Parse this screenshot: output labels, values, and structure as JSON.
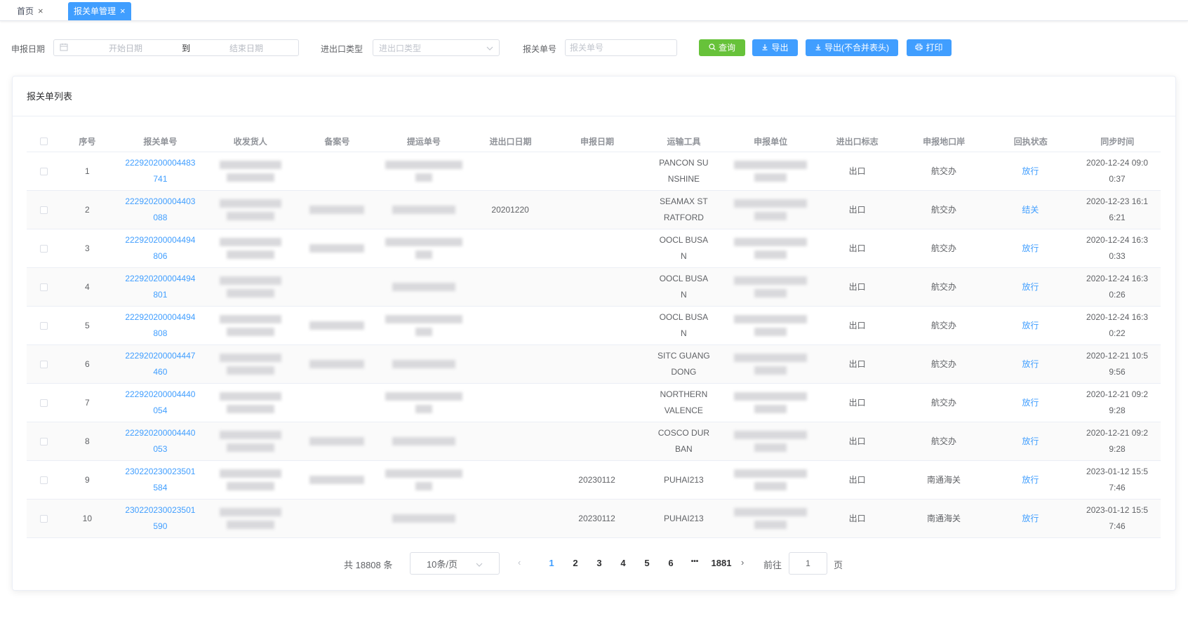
{
  "tabs": [
    {
      "label": "首页",
      "active": false
    },
    {
      "label": "报关单管理",
      "active": true
    }
  ],
  "filters": {
    "declare_date_label": "申报日期",
    "start_placeholder": "开始日期",
    "range_sep": "到",
    "end_placeholder": "结束日期",
    "ie_type_label": "进出口类型",
    "ie_type_placeholder": "进出口类型",
    "decl_no_label": "报关单号",
    "decl_no_placeholder": "报关单号"
  },
  "buttons": {
    "query": "查询",
    "export": "导出",
    "export_nomerge": "导出(不合并表头)",
    "print": "打印"
  },
  "card_title": "报关单列表",
  "columns": [
    "序号",
    "报关单号",
    "收发货人",
    "备案号",
    "提运单号",
    "进出口日期",
    "申报日期",
    "运输工具",
    "申报单位",
    "进出口标志",
    "申报地口岸",
    "回执状态",
    "同步时间"
  ],
  "rows": [
    {
      "idx": "1",
      "no": "222920200004483741",
      "ie_date": "",
      "decl_date": "",
      "transport": "PANCON SUNSHINE",
      "flag": "出口",
      "port": "航交办",
      "status": "放行",
      "sync": "2020-12-24 09:00:37"
    },
    {
      "idx": "2",
      "no": "222920200004403088",
      "ie_date": "20201220",
      "decl_date": "",
      "transport": "SEAMAX STRATFORD",
      "flag": "出口",
      "port": "航交办",
      "status": "结关",
      "sync": "2020-12-23 16:16:21"
    },
    {
      "idx": "3",
      "no": "222920200004494806",
      "ie_date": "",
      "decl_date": "",
      "transport": "OOCL BUSAN",
      "flag": "出口",
      "port": "航交办",
      "status": "放行",
      "sync": "2020-12-24 16:30:33"
    },
    {
      "idx": "4",
      "no": "222920200004494801",
      "ie_date": "",
      "decl_date": "",
      "transport": "OOCL BUSAN",
      "flag": "出口",
      "port": "航交办",
      "status": "放行",
      "sync": "2020-12-24 16:30:26"
    },
    {
      "idx": "5",
      "no": "222920200004494808",
      "ie_date": "",
      "decl_date": "",
      "transport": "OOCL BUSAN",
      "flag": "出口",
      "port": "航交办",
      "status": "放行",
      "sync": "2020-12-24 16:30:22"
    },
    {
      "idx": "6",
      "no": "222920200004447460",
      "ie_date": "",
      "decl_date": "",
      "transport": "SITC GUANGDONG",
      "flag": "出口",
      "port": "航交办",
      "status": "放行",
      "sync": "2020-12-21 10:59:56"
    },
    {
      "idx": "7",
      "no": "222920200004440054",
      "ie_date": "",
      "decl_date": "",
      "transport": "NORTHERN VALENCE",
      "flag": "出口",
      "port": "航交办",
      "status": "放行",
      "sync": "2020-12-21 09:29:28"
    },
    {
      "idx": "8",
      "no": "222920200004440053",
      "ie_date": "",
      "decl_date": "",
      "transport": "COSCO DURBAN",
      "flag": "出口",
      "port": "航交办",
      "status": "放行",
      "sync": "2020-12-21 09:29:28"
    },
    {
      "idx": "9",
      "no": "230220230023501584",
      "ie_date": "",
      "decl_date": "20230112",
      "transport": "PUHAI213",
      "flag": "出口",
      "port": "南通海关",
      "status": "放行",
      "sync": "2023-01-12 15:57:46"
    },
    {
      "idx": "10",
      "no": "230220230023501590",
      "ie_date": "",
      "decl_date": "20230112",
      "transport": "PUHAI213",
      "flag": "出口",
      "port": "南通海关",
      "status": "放行",
      "sync": "2023-01-12 15:57:46"
    }
  ],
  "pagination": {
    "total": "共 18808 条",
    "page_size": "10条/页",
    "pages": [
      "1",
      "2",
      "3",
      "4",
      "5",
      "6"
    ],
    "ellipsis": "•••",
    "last_page": "1881",
    "goto_label": "前往",
    "goto_value": "1",
    "page_suffix": "页"
  },
  "colors": {
    "primary": "#409eff",
    "success": "#67c23a"
  }
}
